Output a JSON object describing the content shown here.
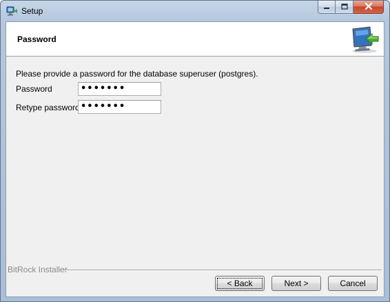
{
  "window": {
    "title": "Setup",
    "icon": "setup-computer-icon"
  },
  "header": {
    "title": "Password",
    "icon": "monitor-arrow-icon"
  },
  "form": {
    "description": "Please provide a password for the database superuser (postgres).",
    "password_label": "Password",
    "password_value": "•••••••",
    "retype_label": "Retype password",
    "retype_value": "•••••••"
  },
  "footer": {
    "installer_label": "BitRock Installer",
    "back_label": "< Back",
    "next_label": "Next >",
    "cancel_label": "Cancel"
  },
  "colors": {
    "frame": "#b3c7de",
    "close_button": "#c8452a",
    "client_background": "#f0f0f0",
    "header_background": "#ffffff",
    "arrow_green": "#4caf2f",
    "monitor_blue": "#2f73c4"
  }
}
